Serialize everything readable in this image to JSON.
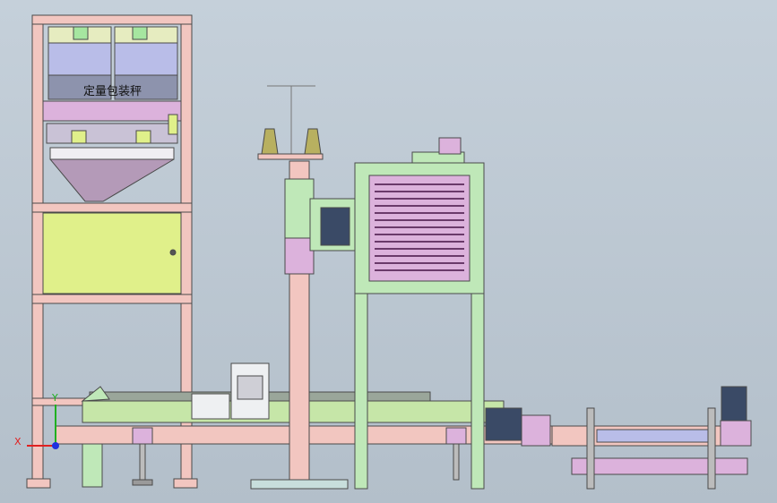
{
  "scale_label": "定量包装秤",
  "axis": {
    "x": "X",
    "y": "Y"
  },
  "colors": {
    "background": "#bcc7d1",
    "pink_frame": "#f2c6c0",
    "hopper_blue": "#b9bde8",
    "purple": "#dcb2dc",
    "green_frame": "#bfe8b8",
    "yellow_green": "#e0f08a",
    "motor_dark": "#3a4a66",
    "axis_x": "#e02020",
    "axis_y": "#20b020",
    "axis_z": "#2030e0"
  }
}
